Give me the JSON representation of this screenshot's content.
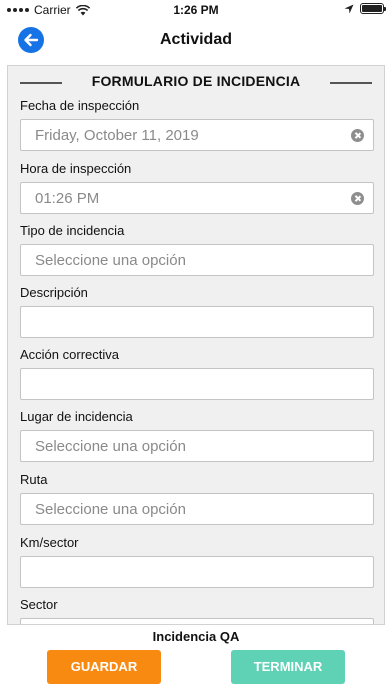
{
  "status_bar": {
    "carrier": "Carrier",
    "time": "1:26 PM",
    "icons": [
      "signal-dots-icon",
      "wifi-icon",
      "location-arrow-icon",
      "battery-icon"
    ]
  },
  "nav": {
    "title": "Actividad",
    "back_icon": "back-arrow-icon"
  },
  "form": {
    "section_title": "FORMULARIO DE INCIDENCIA",
    "fields": [
      {
        "label": "Fecha de inspección",
        "value": "Friday, October 11, 2019",
        "clearable": true
      },
      {
        "label": "Hora de inspección",
        "value": "01:26 PM",
        "clearable": true
      },
      {
        "label": "Tipo de incidencia",
        "placeholder": "Seleccione una opción"
      },
      {
        "label": "Descripción",
        "value": ""
      },
      {
        "label": "Acción correctiva",
        "value": ""
      },
      {
        "label": "Lugar de incidencia",
        "placeholder": "Seleccione una opción"
      },
      {
        "label": "Ruta",
        "placeholder": "Seleccione una opción"
      },
      {
        "label": "Km/sector",
        "value": ""
      },
      {
        "label": "Sector",
        "value": ""
      }
    ]
  },
  "footer": {
    "caption": "Incidencia QA",
    "save_label": "GUARDAR",
    "finish_label": "TERMINAR"
  },
  "colors": {
    "back_button": "#1673e6",
    "save_button": "#f88a12",
    "finish_button": "#5fd1b5",
    "panel_background": "#f0f0f0"
  }
}
